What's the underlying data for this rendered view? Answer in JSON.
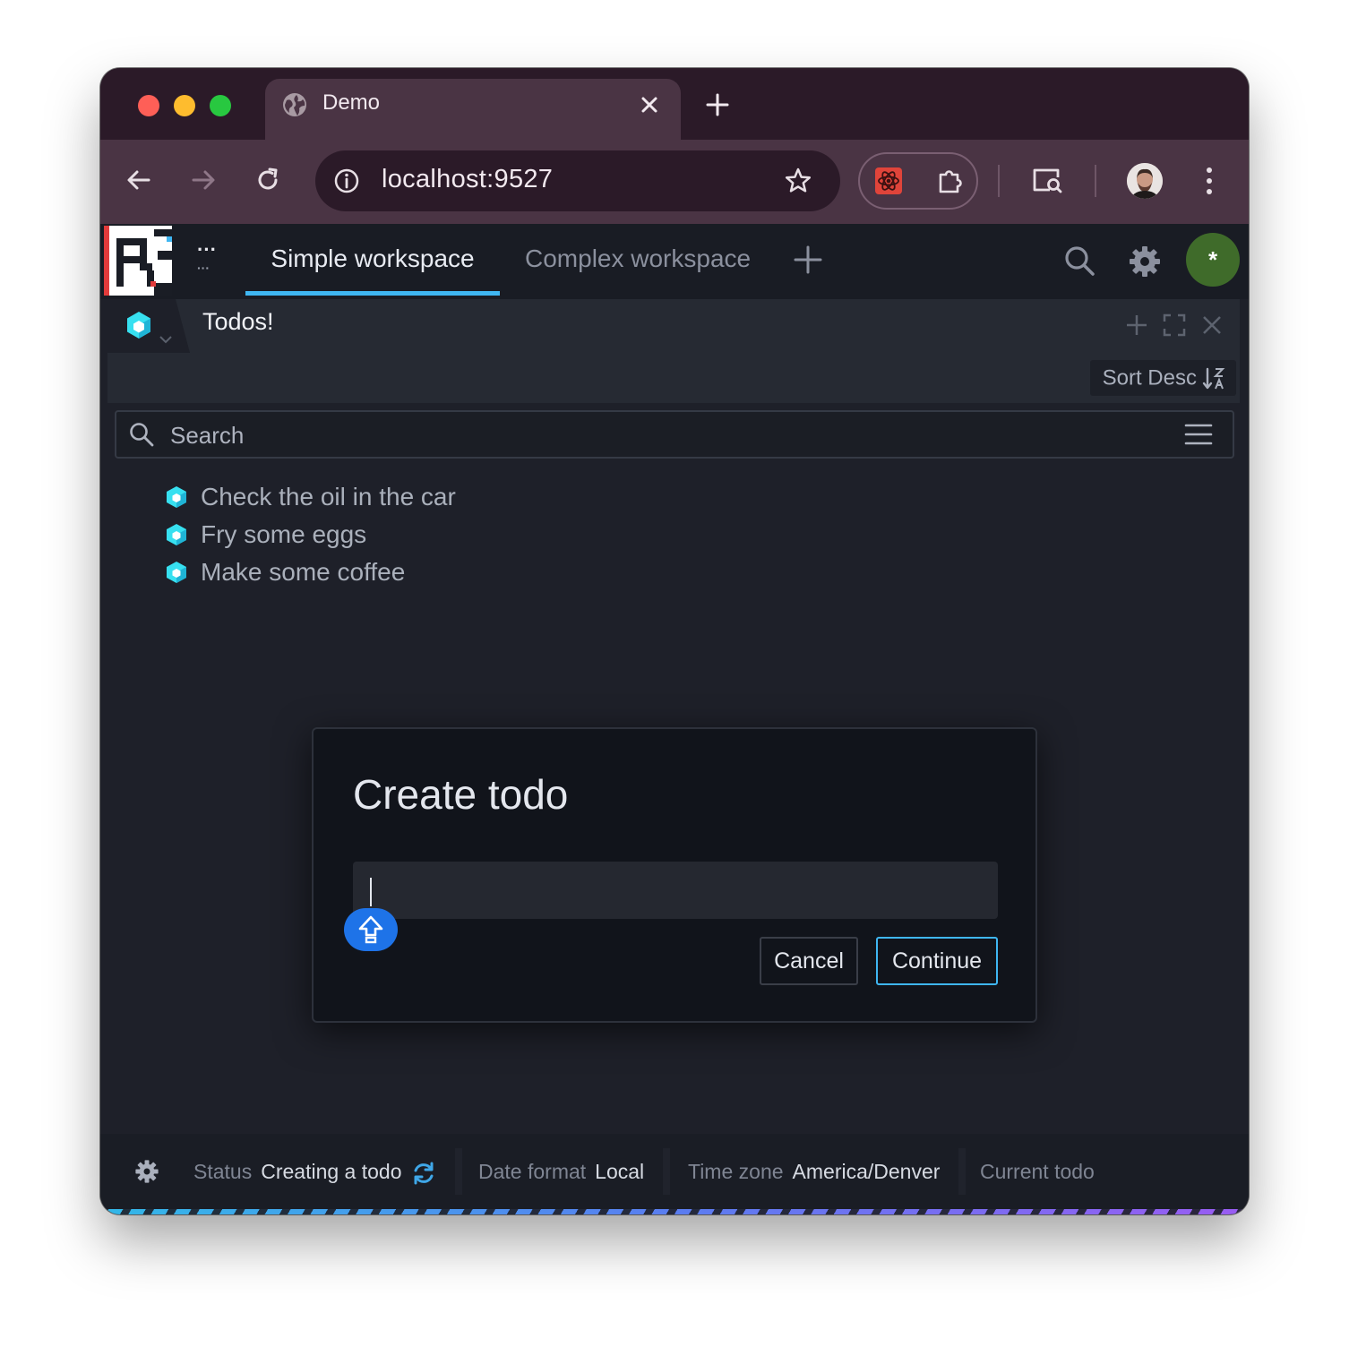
{
  "browser": {
    "tab_title": "Demo",
    "url": "localhost:9527"
  },
  "app": {
    "workspace_tabs": [
      {
        "label": "Simple workspace",
        "active": true
      },
      {
        "label": "Complex workspace",
        "active": false
      }
    ],
    "menu_icon": "more-dots-icon",
    "user_avatar_glyph": "*",
    "accent_color": "#3fb6f2"
  },
  "panel": {
    "title": "Todos!",
    "sort_button_label": "Sort Desc"
  },
  "search": {
    "placeholder": "Search"
  },
  "todos": [
    {
      "text": "Check the oil in the car"
    },
    {
      "text": "Fry some eggs"
    },
    {
      "text": "Make some coffee"
    }
  ],
  "dialog": {
    "title": "Create todo",
    "input_value": "",
    "cancel_label": "Cancel",
    "continue_label": "Continue"
  },
  "statusbar": {
    "status_label": "Status",
    "status_value": "Creating a todo",
    "date_format_label": "Date format",
    "date_format_value": "Local",
    "time_zone_label": "Time zone",
    "time_zone_value": "America/Denver",
    "current_todo_label": "Current todo"
  }
}
